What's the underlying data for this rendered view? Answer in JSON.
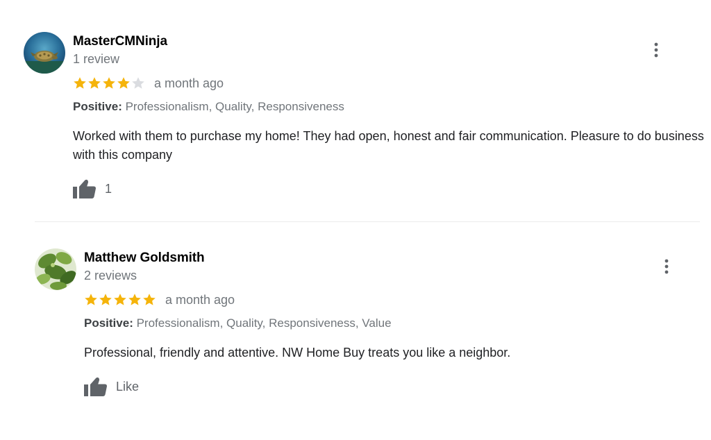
{
  "reviews": [
    {
      "name": "MasterCMNinja",
      "review_count": "1 review",
      "rating": 4,
      "max_rating": 5,
      "time": "a month ago",
      "positive_label": "Positive:",
      "positive_values": "Professionalism, Quality, Responsiveness",
      "text": "Worked with them to purchase my home! They had open, honest and fair communication. Pleasure to do business with this company",
      "like_label": "1",
      "avatar": "turtle-photo-avatar"
    },
    {
      "name": "Matthew Goldsmith",
      "review_count": "2 reviews",
      "rating": 5,
      "max_rating": 5,
      "time": "a month ago",
      "positive_label": "Positive:",
      "positive_values": "Professionalism, Quality, Responsiveness, Value",
      "text": "Professional, friendly and attentive. NW Home Buy treats you like a neighbor.",
      "like_label": "Like",
      "avatar": "leaves-photo-avatar"
    }
  ],
  "icons": {
    "star": "star-icon",
    "thumbs_up": "thumbs-up-icon",
    "more": "more-vertical-icon"
  },
  "colors": {
    "star_filled": "#f5b40b",
    "star_empty": "#dadce0",
    "name": "#000000",
    "muted": "#70757a",
    "text": "#202124",
    "icon": "#5f6368"
  }
}
